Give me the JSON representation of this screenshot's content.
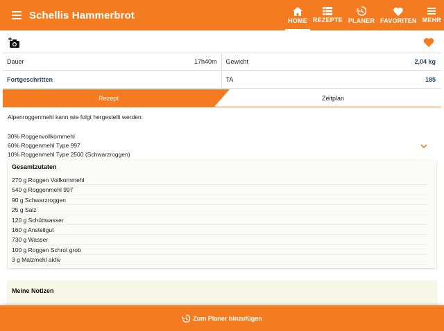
{
  "app": {
    "title": "Schellis Hammerbrot",
    "accent_color": "#f47b20",
    "menu_icon": "hamburger-menu-icon"
  },
  "nav": {
    "items": [
      {
        "label": "HOME",
        "icon": "home-icon",
        "active": true
      },
      {
        "label": "REZEPTE",
        "icon": "list-icon",
        "active": false
      },
      {
        "label": "PLANER",
        "icon": "history-clock-icon",
        "active": false
      },
      {
        "label": "FAVORITEN",
        "icon": "heart-icon",
        "active": false
      },
      {
        "label": "MEHR",
        "icon": "more-icon",
        "active": false
      }
    ]
  },
  "toolbar": {
    "camera_icon": "add-photo-camera-icon",
    "favorite_icon": "heart-icon"
  },
  "info": {
    "duration_label": "Dauer",
    "duration_value": "17h40m",
    "weight_label": "Gewicht",
    "weight_value": "2,04 kg",
    "level_value": "Fortgeschritten",
    "ta_label": "TA",
    "ta_value": "185"
  },
  "tabs": {
    "recipe": "Rezept",
    "schedule": "Zeitplan"
  },
  "description": {
    "intro": "Alpenroggenmehl kann wie folgt hergestellt werden:",
    "lines": [
      "30% Roggenvollkornmehl",
      "60% Roggenmehl Type 997",
      "10% Roggenmehl Type 2500 (Schwarzroggen)"
    ],
    "expand_icon": "chevron-down-icon"
  },
  "ingredients": {
    "title": "Gesamtzutaten",
    "items": [
      "270 g Roggen Vollkornmehl",
      "540 g Roggenmehl 997",
      "90 g Schwarzroggen",
      "25 g Salz",
      "120 g Schüttwasser",
      "160 g Anstellgut",
      "730 g Wasser",
      "100 g Roggen Schrot grob",
      "3 g Malzmehl aktiv"
    ]
  },
  "notes": {
    "title": "Meine Notizen"
  },
  "planner_button": {
    "label": "Zum Planer hinzufügen",
    "icon": "history-clock-icon"
  }
}
